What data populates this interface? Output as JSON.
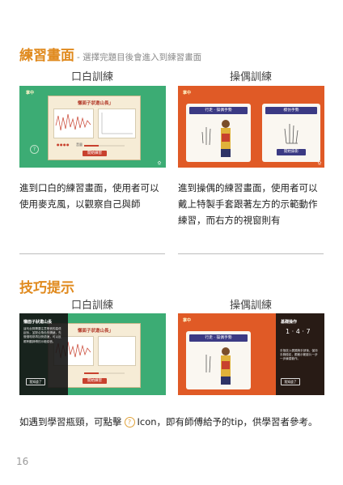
{
  "section1": {
    "title": "練習畫面",
    "subtitle": "- 選擇完題目後會進入到練習畫面",
    "col_left": "口白訓練",
    "col_right": "操偶訓練",
    "text_left": "進到口白的練習畫面，使用者可以使用麥克風，以觀察自己與師",
    "text_right": "進到操偶的練習畫面，使用者可以戴上特製手套跟著左方的示範動作練習，而右方的視窗則有"
  },
  "section2": {
    "title": "技巧提示",
    "col_left": "口白訓練",
    "col_right": "操偶訓練",
    "text_before_icon": "如遇到學習瓶頸，可點擊",
    "text_after_icon": "Icon，即有師傅給予的tip，供學習者參考。"
  },
  "shots": {
    "logo": "掌中",
    "voice_title": "懶面子狀邀山長」",
    "voice_button": "開始練習",
    "voice_mic_label": "音量",
    "puppet_card_left": "行走 · 操偶手勢",
    "puppet_card_right": "模仿手勢",
    "puppet_button": "開始錄影",
    "tip_title_voice": "懶面子狀邀山長",
    "tip_text_voice": "這句台詞需要注意聲音的高低起伏，並配合角色的情緒，先慢慢唸熟再加快語速，可以反覆聆聽師傅的示範錄音。",
    "tip_button_voice": "我知道了",
    "tip_title_puppet": "基礎操作",
    "tip_numbers": "1 · 4 · 7",
    "tip_text_puppet": "手指放入偶頭與手部後，保持手腕穩定，跟著示範影片一步一步練習動作。",
    "tip_button_puppet": "我知道了",
    "help_glyph": "?"
  },
  "page_number": "16"
}
